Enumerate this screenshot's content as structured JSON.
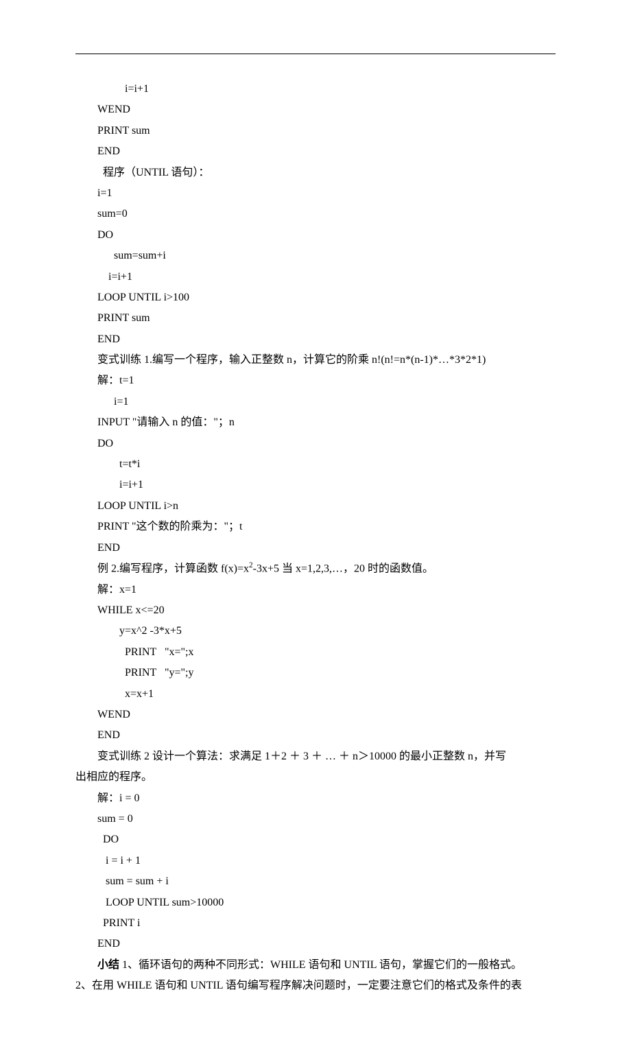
{
  "lines": [
    {
      "cls": "indent2",
      "text": "    i=i+1"
    },
    {
      "cls": "indent1",
      "text": "WEND"
    },
    {
      "cls": "indent1",
      "text": "PRINT sum"
    },
    {
      "cls": "indent1",
      "text": "END"
    },
    {
      "cls": "indent1",
      "text": "  程序（UNTIL 语句）："
    },
    {
      "cls": "indent1",
      "text": "i=1"
    },
    {
      "cls": "indent1",
      "text": "sum=0"
    },
    {
      "cls": "indent1",
      "text": "DO"
    },
    {
      "cls": "indent1",
      "text": "      sum=sum+i"
    },
    {
      "cls": "indent1",
      "text": "    i=i+1"
    },
    {
      "cls": "indent1",
      "text": "LOOP UNTIL i>100"
    },
    {
      "cls": "indent1",
      "text": "PRINT sum"
    },
    {
      "cls": "indent1",
      "text": "END"
    },
    {
      "cls": "indent1",
      "text": "变式训练 1.编写一个程序，输入正整数 n，计算它的阶乘 n!(n!=n*(n-1)*…*3*2*1)"
    },
    {
      "cls": "indent1",
      "text": "解：t=1"
    },
    {
      "cls": "indent1",
      "text": "      i=1"
    },
    {
      "cls": "indent1",
      "text": "INPUT \"请输入 n 的值：\"；n"
    },
    {
      "cls": "indent1",
      "text": "DO"
    },
    {
      "cls": "indent1",
      "text": "        t=t*i"
    },
    {
      "cls": "indent1",
      "text": "        i=i+1"
    },
    {
      "cls": "indent1",
      "text": "LOOP UNTIL i>n"
    },
    {
      "cls": "indent1",
      "text": "PRINT \"这个数的阶乘为：\"；t"
    },
    {
      "cls": "indent1",
      "text": "END"
    },
    {
      "cls": "indent1",
      "html": "例 2.编写程序，计算函数 f(x)=x<span class=\"sup\">2</span>-3x+5 当 x=1,2,3,…，20 时的函数值。"
    },
    {
      "cls": "indent1",
      "text": "解：x=1"
    },
    {
      "cls": "indent1",
      "text": "WHILE x<=20"
    },
    {
      "cls": "indent1",
      "text": "        y=x^2 -3*x+5"
    },
    {
      "cls": "indent1",
      "text": "          PRINT   \"x=\";x"
    },
    {
      "cls": "indent1",
      "text": "          PRINT   \"y=\";y"
    },
    {
      "cls": "indent1",
      "text": "          x=x+1"
    },
    {
      "cls": "indent1",
      "text": "WEND"
    },
    {
      "cls": "indent1",
      "text": "END"
    },
    {
      "cls": "indent1",
      "text": "变式训练 2 设计一个算法：求满足 1＋2 ＋ 3 ＋ … ＋ n＞10000 的最小正整数 n，并写"
    },
    {
      "cls": "noindent",
      "text": "出相应的程序。"
    },
    {
      "cls": "indent1",
      "text": "解：i = 0"
    },
    {
      "cls": "indent1",
      "text": "sum = 0"
    },
    {
      "cls": "indent1",
      "text": "  DO"
    },
    {
      "cls": "indent1",
      "text": "   i = i + 1"
    },
    {
      "cls": "indent1",
      "text": "   sum = sum + i"
    },
    {
      "cls": "indent1",
      "text": "   LOOP UNTIL sum>10000"
    },
    {
      "cls": "indent1",
      "text": "  PRINT i"
    },
    {
      "cls": "indent1",
      "text": "END"
    },
    {
      "cls": "indent1",
      "html": "<span class=\"bold\">小结</span> 1、循环语句的两种不同形式：WHILE 语句和 UNTIL 语句，掌握它们的一般格式。"
    },
    {
      "cls": "noindent",
      "text": "2、在用 WHILE 语句和 UNTIL 语句编写程序解决问题时，一定要注意它们的格式及条件的表"
    }
  ]
}
